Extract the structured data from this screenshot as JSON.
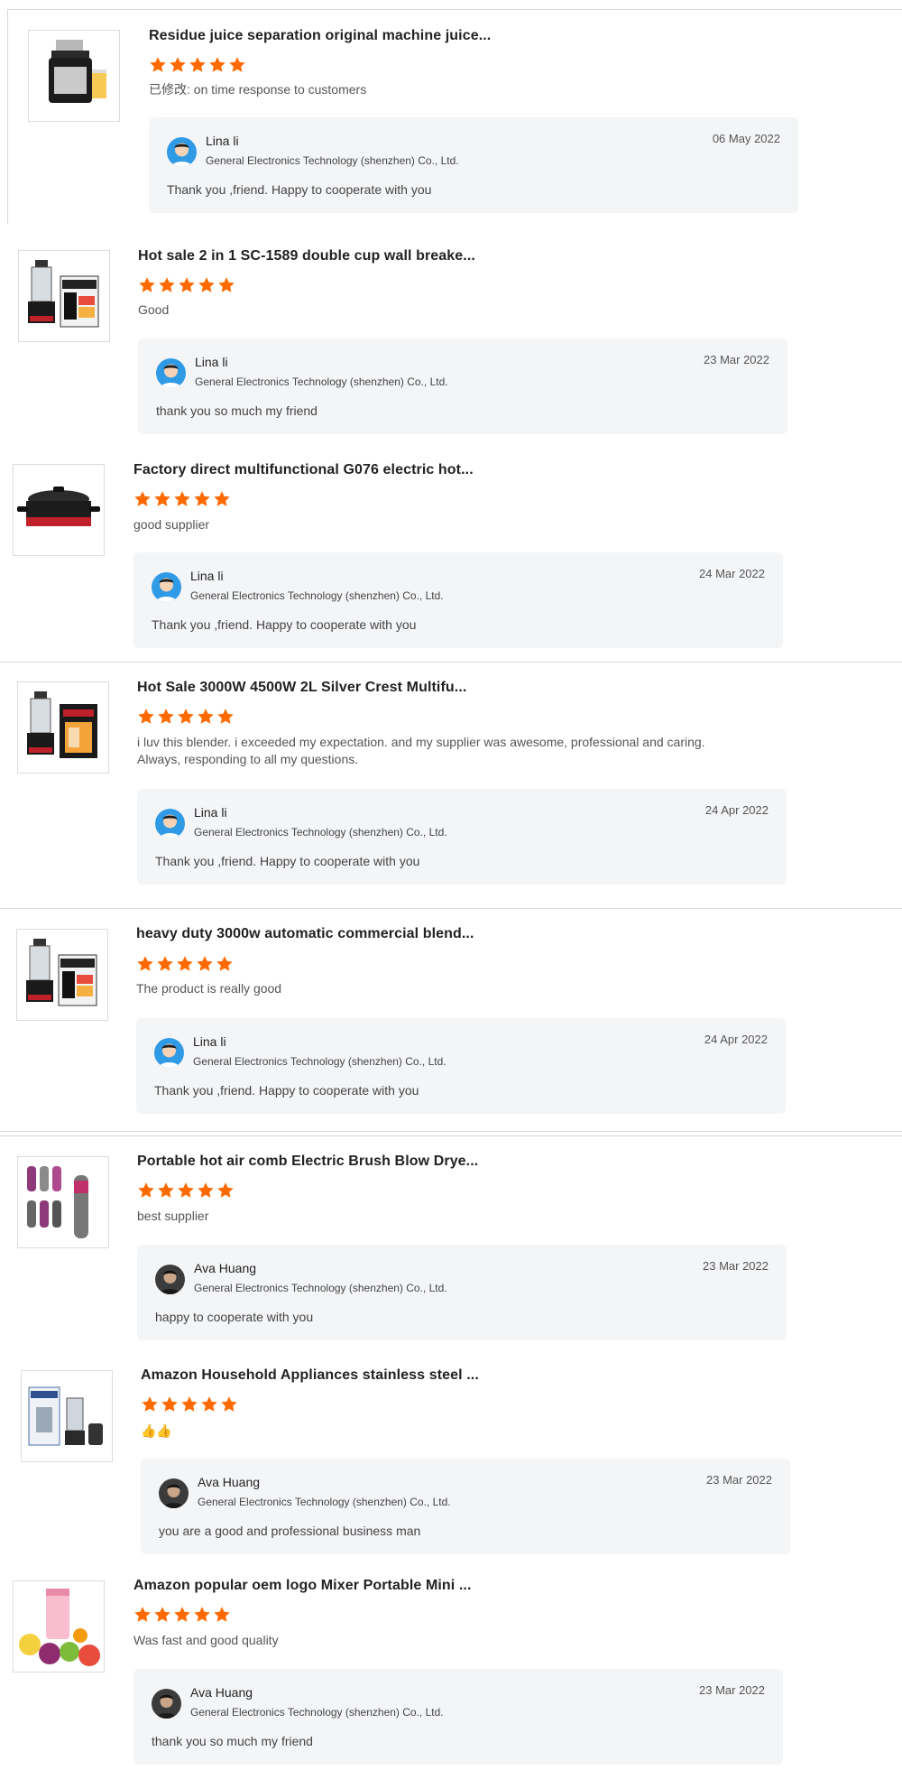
{
  "colors": {
    "star": "#ff6a00",
    "reply_bg": "#f4f5f7",
    "divider": "#d9d9d9"
  },
  "reviews": [
    {
      "product_title": "Residue juice separation original machine juice...",
      "rating": 5,
      "comment": "已修改: on time response to customers",
      "product_icon": "juicer-image",
      "reply": {
        "name": "Lina li",
        "company": "General Electronics Technology (shenzhen) Co., Ltd.",
        "date": "06 May 2022",
        "text": "Thank you ,friend. Happy to cooperate with you",
        "avatar_icon": "user-avatar-icon"
      }
    },
    {
      "product_title": "Hot sale 2 in 1 SC-1589 double cup wall breake...",
      "rating": 5,
      "comment": "Good",
      "product_icon": "blender-box-image",
      "reply": {
        "name": "Lina li",
        "company": "General Electronics Technology (shenzhen) Co., Ltd.",
        "date": "23 Mar 2022",
        "text": "thank you so much my friend",
        "avatar_icon": "user-avatar-icon"
      }
    },
    {
      "product_title": "Factory direct multifunctional G076 electric hot...",
      "rating": 5,
      "comment": "good supplier",
      "product_icon": "electric-pot-image",
      "reply": {
        "name": "Lina li",
        "company": "General Electronics Technology (shenzhen) Co., Ltd.",
        "date": "24 Mar 2022",
        "text": "Thank you ,friend. Happy to cooperate with you",
        "avatar_icon": "user-avatar-icon"
      }
    },
    {
      "product_title": "Hot Sale 3000W 4500W 2L Silver Crest Multifu...",
      "rating": 5,
      "comment": "i luv this blender. i exceeded my expectation. and my supplier was awesome, professional and caring. Always, responding to all my questions.",
      "product_icon": "blender-box-image",
      "reply": {
        "name": "Lina li",
        "company": "General Electronics Technology (shenzhen) Co., Ltd.",
        "date": "24 Apr 2022",
        "text": "Thank you ,friend. Happy to cooperate with you",
        "avatar_icon": "user-avatar-icon"
      }
    },
    {
      "product_title": "heavy duty 3000w automatic commercial blend...",
      "rating": 5,
      "comment": "The product is really good",
      "product_icon": "blender-box-image",
      "reply": {
        "name": "Lina li",
        "company": "General Electronics Technology (shenzhen) Co., Ltd.",
        "date": "24 Apr 2022",
        "text": "Thank you ,friend. Happy to cooperate with you",
        "avatar_icon": "user-avatar-icon"
      }
    },
    {
      "product_title": "Portable hot air comb Electric Brush Blow Drye...",
      "rating": 5,
      "comment": "best supplier",
      "product_icon": "hair-dryer-set-image",
      "reply": {
        "name": "Ava Huang",
        "company": "General Electronics Technology (shenzhen) Co., Ltd.",
        "date": "23 Mar 2022",
        "text": "happy to cooperate with you",
        "avatar_icon": "user-avatar-icon"
      }
    },
    {
      "product_title": "Amazon Household Appliances stainless steel ...",
      "rating": 5,
      "comment": "👍👍",
      "product_icon": "blender-set-image",
      "reply": {
        "name": "Ava Huang",
        "company": "General Electronics Technology (shenzhen) Co., Ltd.",
        "date": "23 Mar 2022",
        "text": "you are a good and professional business man",
        "avatar_icon": "user-avatar-icon"
      }
    },
    {
      "product_title": "Amazon popular oem logo Mixer Portable Mini ...",
      "rating": 5,
      "comment": "Was fast and good quality",
      "product_icon": "portable-blender-image",
      "reply": {
        "name": "Ava Huang",
        "company": "General Electronics Technology (shenzhen) Co., Ltd.",
        "date": "23 Mar 2022",
        "text": "thank you so much my friend",
        "avatar_icon": "user-avatar-icon"
      }
    }
  ]
}
